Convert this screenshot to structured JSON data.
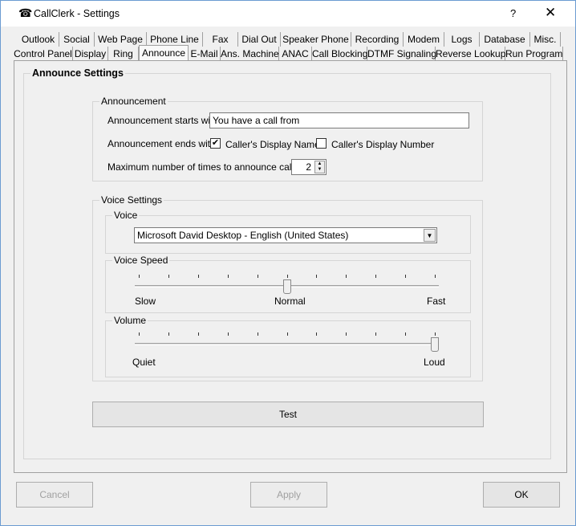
{
  "window": {
    "title": "CallClerk - Settings",
    "help": "?",
    "close": "✕",
    "app_icon": "telephone-icon"
  },
  "tabs_row1": [
    "Outlook",
    "Social",
    "Web Page",
    "Phone Line",
    "Fax",
    "Dial Out",
    "Speaker Phone",
    "Recording",
    "Modem",
    "Logs",
    "Database",
    "Misc."
  ],
  "tabs_row2": [
    "Control Panel",
    "Display",
    "Ring",
    "Announce",
    "E-Mail",
    "Ans. Machine",
    "ANAC",
    "Call Blocking",
    "DTMF Signaling",
    "Reverse Lookup",
    "Run Program"
  ],
  "selected_tab": "Announce",
  "announce": {
    "group_title": "Announce Settings",
    "announcement": {
      "title": "Announcement",
      "starts_label": "Announcement starts with:",
      "starts_value": "You have a call from",
      "ends_label": "Announcement ends with:",
      "name_label": "Caller's Display Name",
      "name_checked": true,
      "number_label": "Caller's Display Number",
      "number_checked": false,
      "max_label": "Maximum number of times to announce caller:",
      "max_value": "2"
    },
    "voice_settings": {
      "title": "Voice Settings",
      "voice_title": "Voice",
      "voice_value": "Microsoft David Desktop - English (United States)",
      "speed_title": "Voice Speed",
      "speed_min": "Slow",
      "speed_mid": "Normal",
      "speed_max": "Fast",
      "speed_level": 5,
      "volume_title": "Volume",
      "volume_min": "Quiet",
      "volume_max": "Loud",
      "volume_level": 10,
      "slider_max": 10
    },
    "test_label": "Test"
  },
  "buttons": {
    "cancel": "Cancel",
    "apply": "Apply",
    "ok": "OK"
  }
}
